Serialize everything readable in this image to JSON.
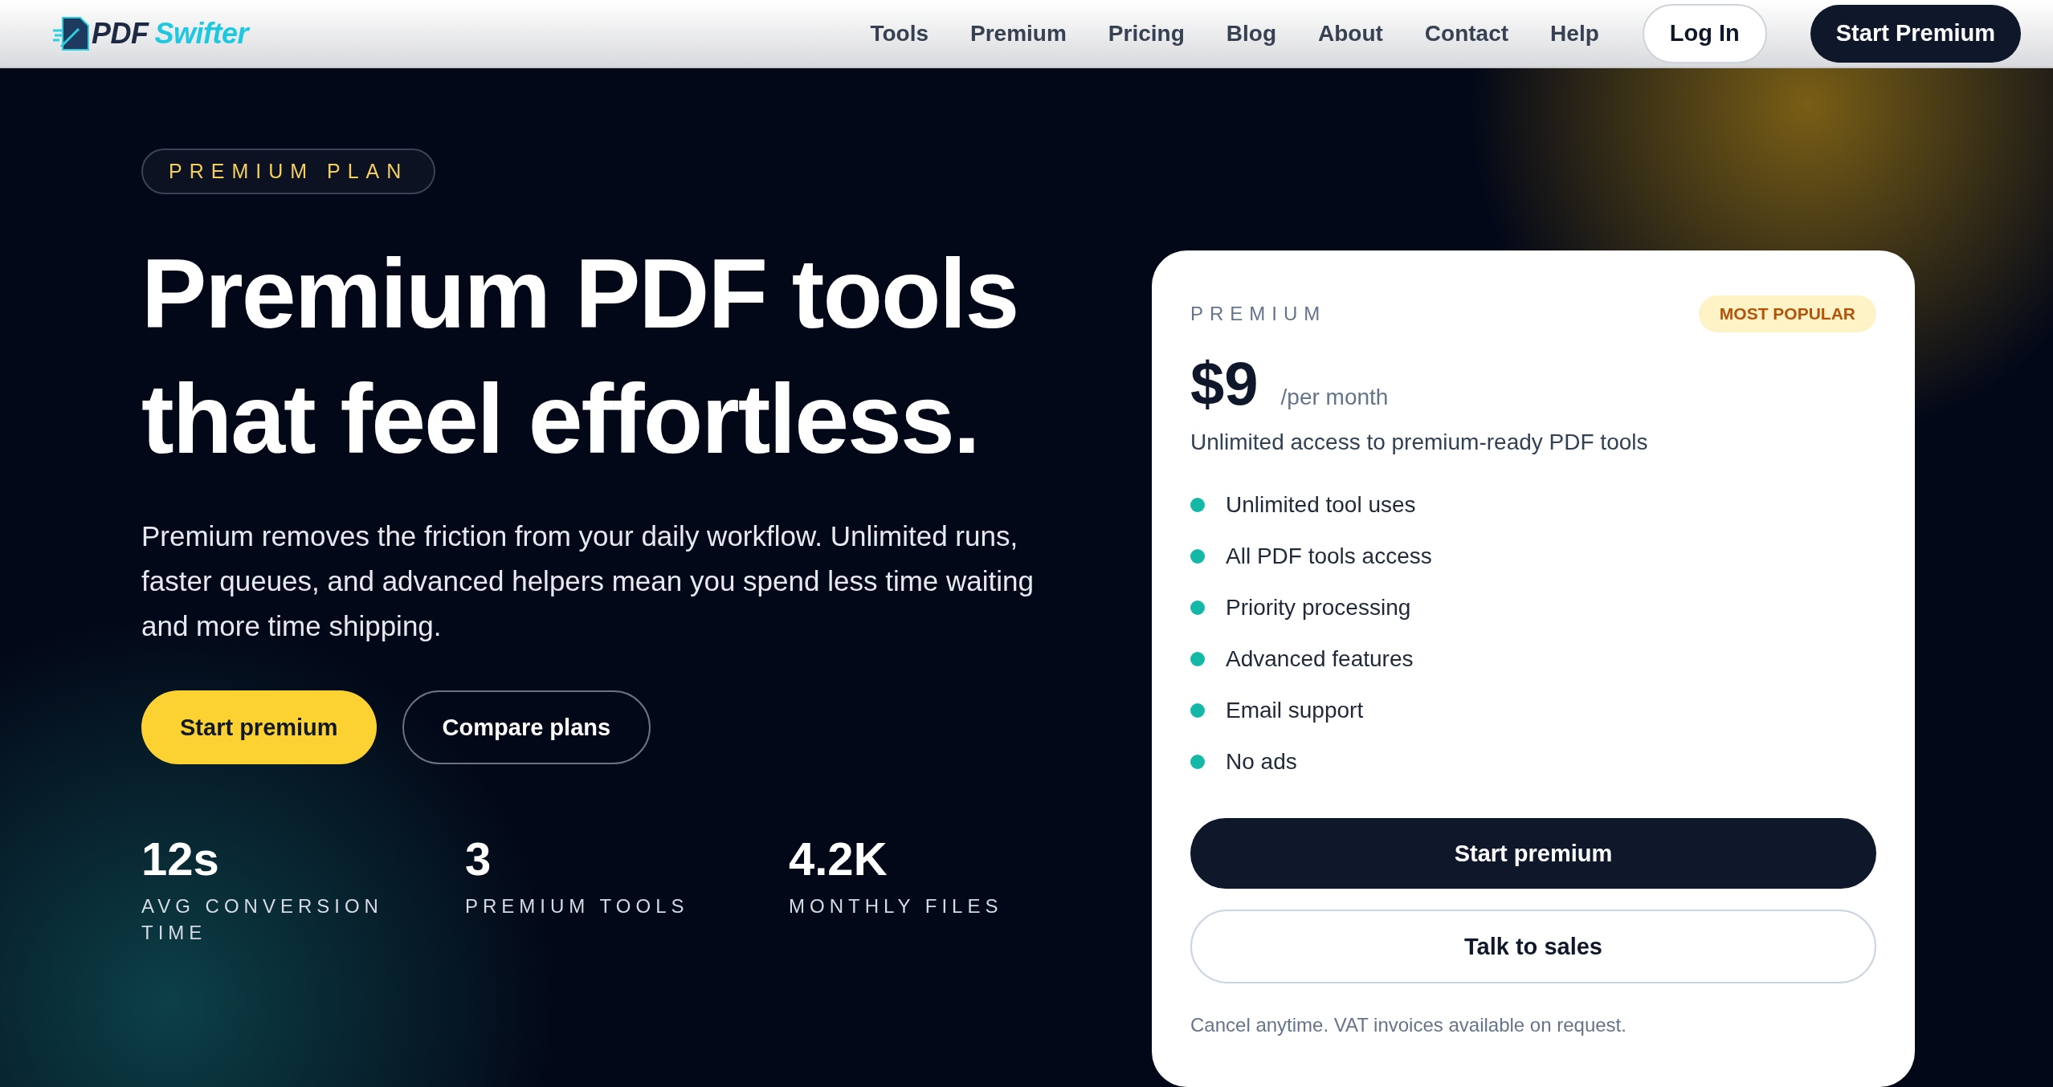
{
  "header": {
    "logo": {
      "primary": "PDF",
      "accent": "Swifter"
    },
    "nav": [
      {
        "label": "Tools"
      },
      {
        "label": "Premium"
      },
      {
        "label": "Pricing"
      },
      {
        "label": "Blog"
      },
      {
        "label": "About"
      },
      {
        "label": "Contact"
      },
      {
        "label": "Help"
      }
    ],
    "login": "Log In",
    "cta": "Start Premium"
  },
  "hero": {
    "badge": "PREMIUM PLAN",
    "heading_lines": [
      "Premium PDF tools",
      "that feel effortless."
    ],
    "description": "Premium removes the friction from your daily workflow. Unlimited runs, faster queues, and advanced helpers mean you spend less time waiting and more time shipping.",
    "buttons": [
      {
        "label": "Start premium",
        "kind": "primary"
      },
      {
        "label": "Compare plans",
        "kind": "outline"
      }
    ],
    "stats": [
      {
        "value": "12s",
        "label": "AVG CONVERSION TIME"
      },
      {
        "value": "3",
        "label": "PREMIUM TOOLS"
      },
      {
        "value": "4.2K",
        "label": "MONTHLY FILES"
      }
    ]
  },
  "plan_card": {
    "name": "PREMIUM",
    "tag": "MOST POPULAR",
    "price": "$9",
    "period": "/per month",
    "summary": "Unlimited access to premium-ready PDF tools",
    "features": [
      "Unlimited tool uses",
      "All PDF tools access",
      "Priority processing",
      "Advanced features",
      "Email support",
      "No ads"
    ],
    "buttons": [
      {
        "label": "Start premium",
        "kind": "primary"
      },
      {
        "label": "Talk to sales",
        "kind": "outline"
      }
    ],
    "note": "Cancel anytime. VAT invoices available on request."
  }
}
